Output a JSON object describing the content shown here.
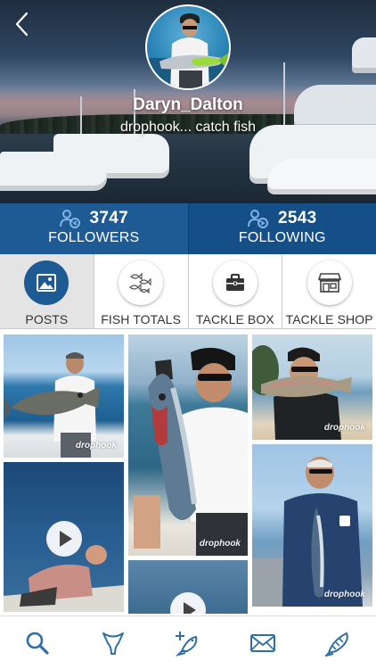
{
  "profile": {
    "username": "Daryn_Dalton",
    "tagline": "drophook... catch fish"
  },
  "stats": {
    "followers": {
      "count": "3747",
      "label": "FOLLOWERS"
    },
    "following": {
      "count": "2543",
      "label": "FOLLOWING"
    }
  },
  "tabs": [
    {
      "label": "POSTS",
      "icon": "image-icon",
      "active": true
    },
    {
      "label": "FISH TOTALS",
      "icon": "fish-school-icon",
      "active": false
    },
    {
      "label": "TACKLE BOX",
      "icon": "briefcase-icon",
      "active": false
    },
    {
      "label": "TACKLE SHOP",
      "icon": "storefront-icon",
      "active": false
    }
  ],
  "posts": [
    {
      "watermark": "drophook",
      "type": "photo"
    },
    {
      "watermark": "drophook",
      "type": "photo"
    },
    {
      "watermark": "drophook",
      "type": "photo"
    },
    {
      "watermark": "",
      "type": "video"
    },
    {
      "watermark": "drophook",
      "type": "photo"
    },
    {
      "watermark": "",
      "type": "video"
    }
  ],
  "bottom_nav": [
    "search-icon",
    "fish-tail-icon",
    "add-fish-icon",
    "mail-icon",
    "fish-measure-icon"
  ],
  "colors": {
    "brand_blue": "#1e5a93",
    "nav_icon": "#2f6fa8"
  }
}
